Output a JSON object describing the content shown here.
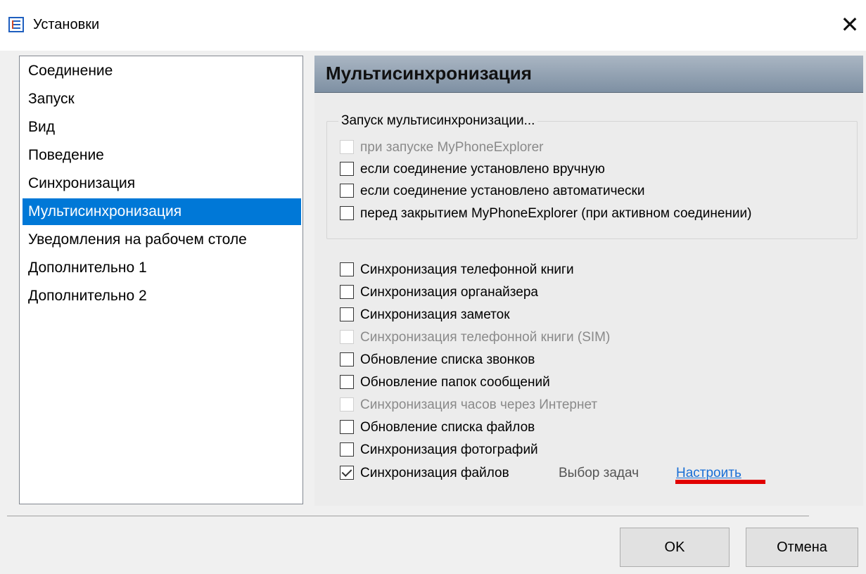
{
  "window": {
    "title": "Установки"
  },
  "sidebar": {
    "items": [
      {
        "label": "Соединение",
        "selected": false
      },
      {
        "label": "Запуск",
        "selected": false
      },
      {
        "label": "Вид",
        "selected": false
      },
      {
        "label": "Поведение",
        "selected": false
      },
      {
        "label": "Синхронизация",
        "selected": false
      },
      {
        "label": "Мультисинхронизация",
        "selected": true
      },
      {
        "label": "Уведомления на рабочем столе",
        "selected": false
      },
      {
        "label": "Дополнительно 1",
        "selected": false
      },
      {
        "label": "Дополнительно 2",
        "selected": false
      }
    ]
  },
  "panel": {
    "title": "Мультисинхронизация",
    "group": {
      "legend": "Запуск мультисинхронизации...",
      "options": [
        {
          "label": "при запуске MyPhoneExplorer",
          "checked": false,
          "disabled": true
        },
        {
          "label": "если соединение установлено вручную",
          "checked": false,
          "disabled": false
        },
        {
          "label": "если соединение установлено автоматически",
          "checked": false,
          "disabled": false
        },
        {
          "label": "перед закрытием MyPhoneExplorer (при активном соединении)",
          "checked": false,
          "disabled": false
        }
      ]
    },
    "sync_options": [
      {
        "label": "Синхронизация телефонной книги",
        "checked": false,
        "disabled": false
      },
      {
        "label": "Синхронизация органайзера",
        "checked": false,
        "disabled": false
      },
      {
        "label": "Синхронизация заметок",
        "checked": false,
        "disabled": false
      },
      {
        "label": "Синхронизация телефонной книги (SIM)",
        "checked": false,
        "disabled": true
      },
      {
        "label": "Обновление списка звонков",
        "checked": false,
        "disabled": false
      },
      {
        "label": "Обновление папок сообщений",
        "checked": false,
        "disabled": false
      },
      {
        "label": "Синхронизация часов через Интернет",
        "checked": false,
        "disabled": true
      },
      {
        "label": "Обновление списка файлов",
        "checked": false,
        "disabled": false
      },
      {
        "label": "Синхронизация фотографий",
        "checked": false,
        "disabled": false
      },
      {
        "label": "Синхронизация файлов",
        "checked": true,
        "disabled": false
      }
    ],
    "tasks_label": "Выбор задач",
    "configure_link": "Настроить"
  },
  "footer": {
    "ok_label": "OK",
    "cancel_label": "Отмена"
  },
  "colors": {
    "selection": "#0078d7",
    "link": "#1a6fd6",
    "annotation_red": "#e10000"
  }
}
